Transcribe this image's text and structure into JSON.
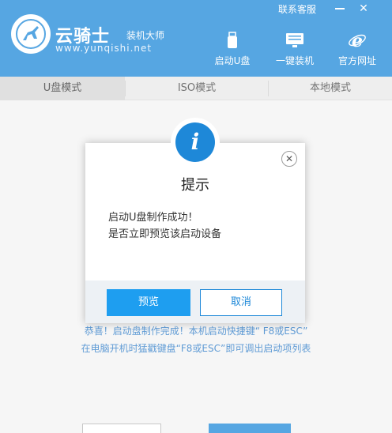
{
  "header": {
    "brand_name": "云骑士",
    "brand_sub": "装机大师",
    "brand_url": "www.yunqishi.net",
    "contact_link": "联系客服",
    "minimize_label": "",
    "close_label": "✕",
    "nav": [
      {
        "label": "启动U盘",
        "icon": "usb-drive-icon"
      },
      {
        "label": "一键装机",
        "icon": "monitor-icon"
      },
      {
        "label": "官方网址",
        "icon": "ie-browser-icon"
      }
    ]
  },
  "tabs": [
    {
      "label": "U盘模式",
      "active": true
    },
    {
      "label": "ISO模式",
      "active": false
    },
    {
      "label": "本地模式",
      "active": false
    }
  ],
  "background_message": {
    "line1": "恭喜！启动盘制作完成！本机启动快捷键“ F8或ESC”",
    "line2": "在电脑开机时猛戳键盘“F8或ESC”即可调出启动项列表"
  },
  "dialog": {
    "icon_glyph": "i",
    "close_glyph": "✕",
    "title": "提示",
    "line1": "启动U盘制作成功！",
    "line2": "是否立即预览该启动设备",
    "confirm_label": "预览",
    "cancel_label": "取消"
  },
  "colors": {
    "brand_blue": "#1e88d8",
    "button_blue": "#1e9ef0",
    "message_blue": "#2a7ac7"
  }
}
